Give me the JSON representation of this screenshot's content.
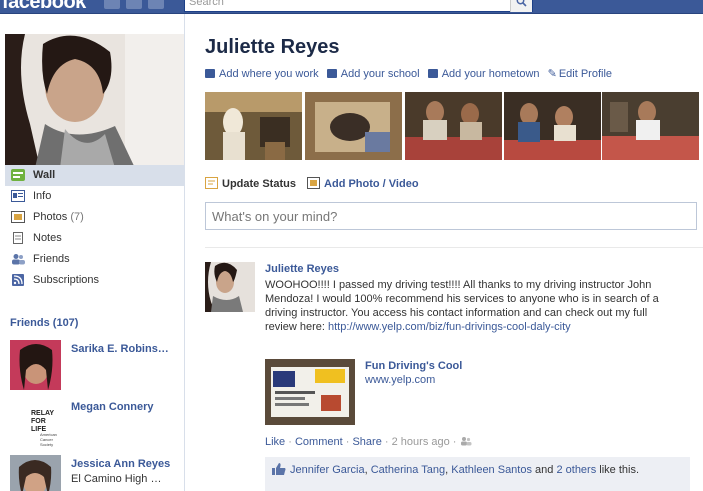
{
  "header": {
    "logo": "facebook",
    "search_placeholder": "Search"
  },
  "profile": {
    "name": "Juliette Reyes",
    "info_links": {
      "work": "Add where you work",
      "school": "Add your school",
      "hometown": "Add your hometown",
      "edit": "Edit Profile"
    }
  },
  "sidebar": {
    "items": [
      {
        "label": "Wall",
        "count": "",
        "icon": "wall-icon"
      },
      {
        "label": "Info",
        "count": "",
        "icon": "info-icon"
      },
      {
        "label": "Photos",
        "count": "(7)",
        "icon": "photos-icon"
      },
      {
        "label": "Notes",
        "count": "",
        "icon": "notes-icon"
      },
      {
        "label": "Friends",
        "count": "",
        "icon": "friends-icon"
      },
      {
        "label": "Subscriptions",
        "count": "",
        "icon": "subscriptions-icon"
      }
    ],
    "friends_heading": "Friends (107)",
    "friends": [
      {
        "name": "Sarika E. Robins…",
        "sub": ""
      },
      {
        "name": "Megan Connery",
        "sub": ""
      },
      {
        "name": "Jessica Ann Reyes",
        "sub": "El Camino High …"
      }
    ],
    "relay_text": "RELAY FOR LIFE",
    "acs_text": "American Cancer Society"
  },
  "publisher": {
    "update_status": "Update Status",
    "add_photo": "Add Photo / Video",
    "placeholder": "What's on your mind?"
  },
  "story": {
    "author": "Juliette Reyes",
    "message": "WOOHOO!!!! I passed my driving test!!!! All thanks to my driving instructor John Mendoza! I would 100% recommend his services to anyone who is in search of a driving instructor. You access his contact information and can check out my full review here:",
    "link": "http://www.yelp.com/biz/fun-drivings-cool-daly-city",
    "attachment": {
      "title": "Fun Driving's Cool",
      "url": "www.yelp.com"
    },
    "actions": {
      "like": "Like",
      "comment": "Comment",
      "share": "Share",
      "time": "2 hours ago"
    },
    "likes": {
      "names": [
        "Jennifer Garcia",
        "Catherina Tang",
        "Kathleen Santos"
      ],
      "and": "and",
      "others": "2 others",
      "suffix": "like this."
    }
  },
  "colors": {
    "brand": "#3b5998",
    "link": "#3b5998",
    "nav_active": "#d8dfea"
  }
}
